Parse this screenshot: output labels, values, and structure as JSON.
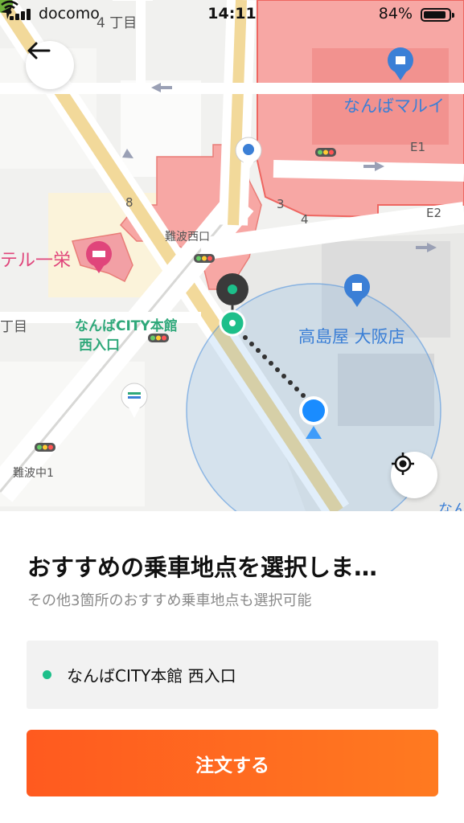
{
  "status_bar": {
    "carrier": "docomo",
    "time": "14:11",
    "battery": "84%",
    "battery_level": 0.84
  },
  "map": {
    "labels": {
      "block_4": "4 丁目",
      "chome": "丁目",
      "hotel": "テル一栄",
      "namba_nishiguchi": "難波西口",
      "namba_city_line1": "なんばCITY本館",
      "namba_city_line2": "西入口",
      "marui": "なんばマルイ",
      "takashimaya": "高島屋 大阪店",
      "namba_naka": "難波中1",
      "e1": "E1",
      "e2": "E2",
      "num_8": "8",
      "num_3": "3",
      "num_4": "4",
      "nan": "なん"
    },
    "colors": {
      "store_zone": "#f6a3a0",
      "route_dot": "#333333",
      "pickup_green": "#1dbf8a",
      "user_blue": "#1a8cff"
    }
  },
  "panel": {
    "title": "おすすめの乗車地点を選択しま…",
    "subtitle": "その他3箇所のおすすめ乗車地点も選択可能",
    "pickup_point": "なんばCITY本館 西入口",
    "order_button": "注文する"
  },
  "icons": {
    "back": "arrow-left-icon",
    "locate": "crosshair-icon",
    "shopping": "shopping-bag-icon",
    "hotel": "bed-icon",
    "traffic_light": "traffic-light-icon",
    "wifi": "wifi-icon",
    "location_arrow": "location-arrow-icon"
  }
}
